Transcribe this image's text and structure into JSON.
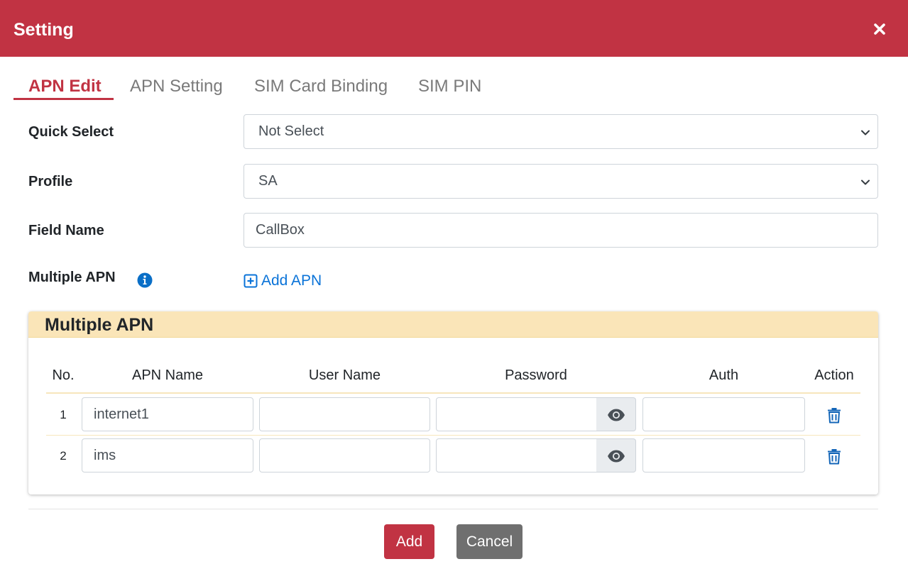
{
  "dialog": {
    "title": "Setting",
    "close_icon": "close-icon",
    "accent_color": "#c13343"
  },
  "tabs": [
    {
      "label": "APN Edit",
      "active": true
    },
    {
      "label": "APN Setting",
      "active": false
    },
    {
      "label": "SIM Card Binding",
      "active": false
    },
    {
      "label": "SIM PIN",
      "active": false
    }
  ],
  "form": {
    "quick_select": {
      "label": "Quick Select",
      "value": "Not Select"
    },
    "profile": {
      "label": "Profile",
      "value": "SA"
    },
    "field_name": {
      "label": "Field Name",
      "value": "CallBox"
    },
    "multiple_apn": {
      "label": "Multiple APN",
      "info_icon": "info-icon",
      "add_label": "Add APN",
      "add_icon": "plus-square-icon"
    }
  },
  "apn_table": {
    "title": "Multiple APN",
    "header_color": "#fae5b8",
    "columns": [
      "No.",
      "APN Name",
      "User Name",
      "Password",
      "Auth",
      "Action"
    ],
    "rows": [
      {
        "no": "1",
        "apn_name": "internet1",
        "user_name": "",
        "password": "",
        "auth": ""
      },
      {
        "no": "2",
        "apn_name": "ims",
        "user_name": "",
        "password": "",
        "auth": ""
      }
    ],
    "row_icons": {
      "show_password": "eye-icon",
      "delete": "trash-icon"
    }
  },
  "footer": {
    "add_label": "Add",
    "cancel_label": "Cancel"
  }
}
